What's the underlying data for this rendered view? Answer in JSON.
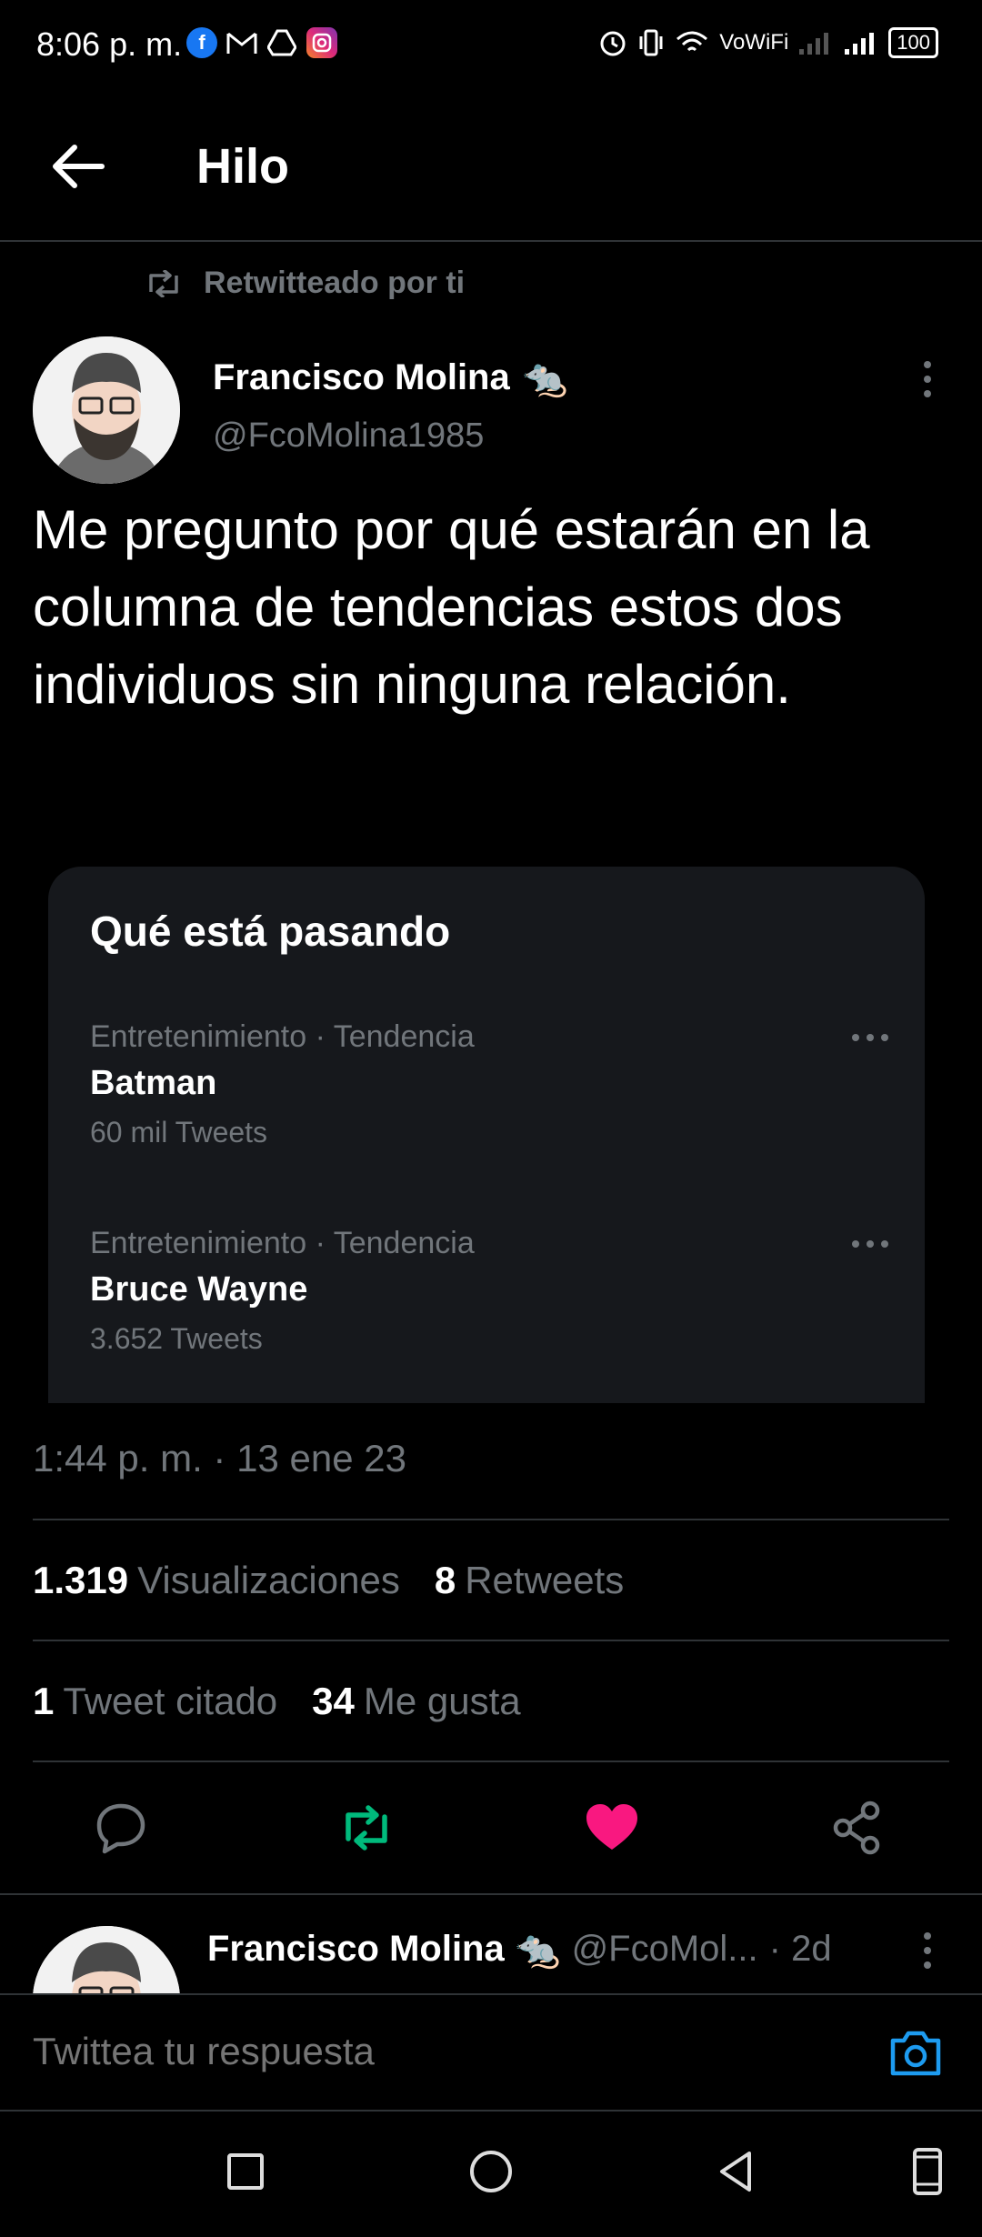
{
  "status_bar": {
    "time": "8:06 p. m.",
    "apps": [
      "facebook-icon",
      "gmail-icon",
      "drive-icon",
      "instagram-icon"
    ],
    "network_label": "VoWiFi",
    "battery": "100"
  },
  "header": {
    "title": "Hilo"
  },
  "retweet": {
    "label": "Retwitteado por ti"
  },
  "tweet": {
    "author_name": "Francisco Molina",
    "author_emoji": "🐀",
    "author_handle": "@FcoMolina1985",
    "text": "Me pregunto por qué estarán en la columna de tendencias estos dos individuos sin ninguna relación.",
    "timestamp": "1:44 p. m. · 13 ene 23"
  },
  "card": {
    "title": "Qué está pasando",
    "trends": [
      {
        "meta": "Entretenimiento · Tendencia",
        "name": "Batman",
        "count": "60 mil Tweets"
      },
      {
        "meta": "Entretenimiento · Tendencia",
        "name": "Bruce Wayne",
        "count": "3.652 Tweets"
      }
    ]
  },
  "stats": {
    "views_num": "1.319",
    "views_label": "Visualizaciones",
    "retweets_num": "8",
    "retweets_label": "Retweets",
    "quotes_num": "1",
    "quotes_label": "Tweet citado",
    "likes_num": "34",
    "likes_label": "Me gusta"
  },
  "reply": {
    "author_name": "Francisco Molina",
    "author_handle": "@FcoMol...",
    "time": "· 2d"
  },
  "compose": {
    "placeholder": "Twittea tu respuesta"
  },
  "colors": {
    "accent": "#1d9bf0",
    "retweet_active": "#00ba7c",
    "like_active": "#f91880",
    "muted": "#71767b"
  }
}
